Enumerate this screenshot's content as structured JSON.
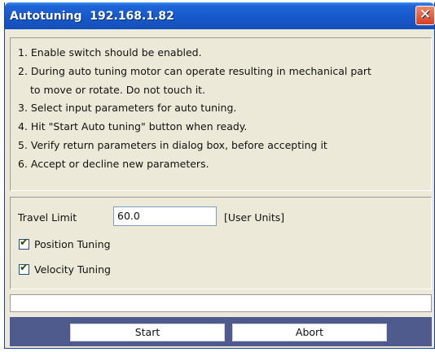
{
  "window": {
    "title": "Autotuning  192.168.1.82",
    "close_glyph": "✕"
  },
  "instructions": [
    "1. Enable switch should be enabled.",
    "2. During auto tuning motor can operate resulting in mechanical part",
    "to move or rotate. Do not touch it.",
    "3. Select input parameters for auto tuning.",
    "4. Hit \"Start Auto tuning\" button when ready.",
    "5. Verify return parameters in dialog box, before accepting it",
    "6. Accept or decline new parameters."
  ],
  "params": {
    "travel_limit_label": "Travel Limit",
    "travel_limit_value": "60.0",
    "units_label": "[User Units]",
    "position_tuning": {
      "label": "Position Tuning",
      "checked": true
    },
    "velocity_tuning": {
      "label": "Velocity Tuning",
      "checked": true
    }
  },
  "status": {
    "text": ""
  },
  "buttons": {
    "start_label": "Start",
    "abort_label": "Abort"
  },
  "colors": {
    "titlebar": "#1758c9",
    "close_button": "#d6401e",
    "dialog_background": "#ece9d8",
    "button_bar": "#4e5b8c"
  },
  "icons": {
    "close": "close-icon",
    "check": "checkmark-icon"
  }
}
